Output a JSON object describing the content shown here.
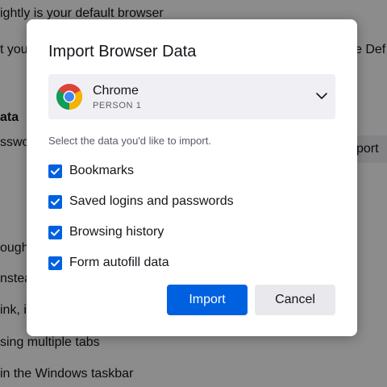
{
  "background": {
    "lines": [
      "ightly is your default browser",
      "t you",
      "e Def",
      "ata",
      "sswo",
      "port",
      "ough",
      "nstea",
      "ink, in",
      "sing multiple tabs",
      "in the Windows taskbar"
    ]
  },
  "dialog": {
    "title": "Import Browser Data",
    "browser_select": {
      "browser_name": "Chrome",
      "profile": "PERSON 1",
      "icon": "chrome-icon"
    },
    "hint": "Select the data you'd like to import.",
    "options": [
      {
        "label": "Bookmarks",
        "checked": true
      },
      {
        "label": "Saved logins and passwords",
        "checked": true
      },
      {
        "label": "Browsing history",
        "checked": true
      },
      {
        "label": "Form autofill data",
        "checked": true
      }
    ],
    "import_label": "Import",
    "cancel_label": "Cancel"
  },
  "colors": {
    "accent": "#0061e0",
    "overlay": "rgba(0,0,0,0.44)",
    "secondary_button": "#e9e9ed"
  }
}
